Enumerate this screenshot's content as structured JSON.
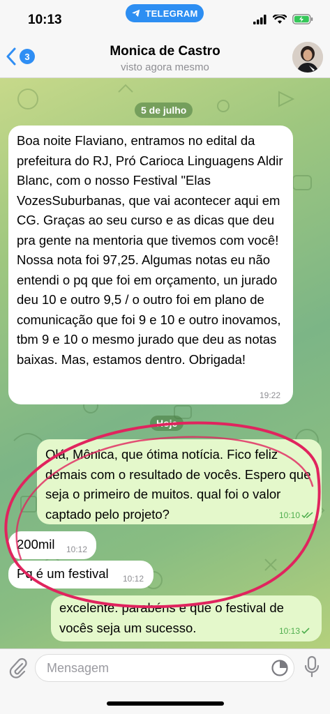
{
  "status_bar": {
    "time": "10:13",
    "app_pill": "TELEGRAM"
  },
  "header": {
    "back_count": "3",
    "contact_name": "Monica de Castro",
    "contact_status": "visto agora mesmo"
  },
  "dates": {
    "first": "5 de julho",
    "second": "Hoje"
  },
  "messages": [
    {
      "direction": "in",
      "text": "Boa noite Flaviano, entramos no edital da prefeitura do RJ, Pró Carioca Linguagens Aldir Blanc, com o nosso Festival \"Elas VozesSuburbanas, que vai acontecer aqui em CG. Graças ao seu curso e as dicas que deu pra gente na mentoria que tivemos com você! Nossa nota foi 97,25. Algumas notas eu não entendi o pq que foi em orçamento, un jurado deu 10 e outro 9,5 / o outro foi em plano de comunicação que foi 9 e 10 e outro inovamos, tbm 9 e 10 o mesmo jurado que deu as notas baixas. Mas, estamos dentro. Obrigada!",
      "time": "19:22"
    },
    {
      "direction": "out",
      "text": "Olá, Mônica, que ótima notícia. Fico feliz demais com o resultado de vocês. Espero que seja o primeiro de muitos. qual foi o valor captado pelo projeto?",
      "time": "10:10"
    },
    {
      "direction": "in",
      "text": "200mil",
      "time": "10:12"
    },
    {
      "direction": "in",
      "text": "Pq é um festival",
      "time": "10:12"
    },
    {
      "direction": "out",
      "text": "excelente. parabéns e que o festival de vocês seja um sucesso.",
      "time": "10:13"
    }
  ],
  "input": {
    "placeholder": "Mensagem"
  },
  "icons": {
    "attach": "paperclip-icon",
    "sticker": "sticker-icon",
    "mic": "microphone-icon",
    "back": "chevron-left-icon",
    "wifi": "wifi-icon",
    "signal": "signal-icon",
    "battery": "battery-icon"
  },
  "colors": {
    "accent": "#2d8ef2",
    "outgoing_bubble": "#e4f8cb",
    "incoming_bubble": "#ffffff",
    "annotation": "#e0245e"
  }
}
